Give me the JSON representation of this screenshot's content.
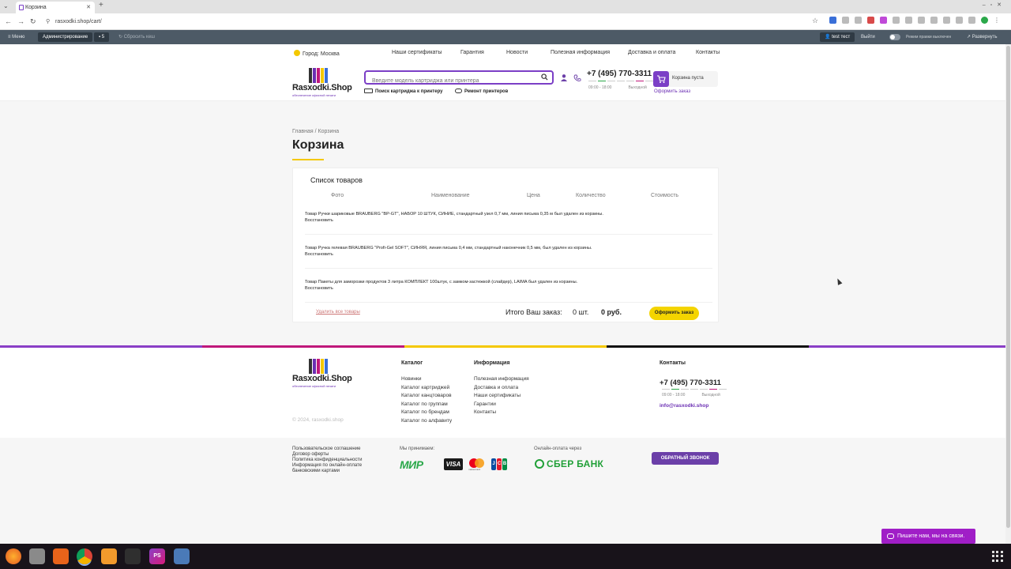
{
  "browser": {
    "tab_title": "Корзина",
    "url": "rasxodki.shop/cart/"
  },
  "adminbar": {
    "menu": "Меню",
    "admin": "Администрирование",
    "comments": "5",
    "reset_cache": "Сбросить кеш",
    "user": "test тест",
    "logout": "Выйти",
    "edit_mode": "Режим правки",
    "edit_state": "выключен",
    "expand": "Развернуть"
  },
  "header": {
    "city": "Город: Москва",
    "nav": [
      "Наши сертификаты",
      "Гарантия",
      "Новости",
      "Полезная информация",
      "Доставка и оплата",
      "Контакты"
    ],
    "logo_text": "Rasxodki.Shop",
    "logo_sub": "обеспечение офисной печати",
    "search_placeholder": "Введите модель картриджа или принтера",
    "link_find_cartridge": "Поиск картриджа к принтеру",
    "link_repair": "Ремонт принтеров",
    "phone": "+7 (495) 770-3311",
    "hours": "09:00 - 18:00",
    "day_off": "Выходной",
    "cart_label": "Корзина пуста",
    "order_link": "Оформить заказ"
  },
  "page": {
    "crumb_home": "Главная",
    "crumb_sep": "/",
    "crumb_current": "Корзина",
    "title": "Корзина"
  },
  "cart": {
    "list_title": "Список товаров",
    "columns": [
      "Фото",
      "Наименование",
      "Цена",
      "Количество",
      "Стоимость"
    ],
    "removed": [
      {
        "text": "Товар Ручки шариковые BRAUBERG \"BP-GT\", НАБОР 10 ШТУК, СИНИЕ, стандартный узел 0,7 мм, линия письма 0,35 м был удален из корзины.",
        "restore": "Восстановить"
      },
      {
        "text": "Товар Ручка гелевая BRAUBERG \"Profi-Gel SOFT\", СИНЯЯ, линия письма 0,4 мм, стандартный наконечник 0,5 мм, был удален из корзины.",
        "restore": "Восстановить"
      },
      {
        "text": "Товар Пакеты для заморозки продуктов 3 литра КОМПЛЕКТ 100штук, с замком-застежкой (слайдер), LAIMA был удален из корзины.",
        "restore": "Восстановить"
      }
    ],
    "delete_all": "Удалить все товары",
    "total_label": "Итого Ваш заказ:",
    "total_qty": "0 шт.",
    "total_sum": "0 руб.",
    "order_button": "Оформить заказ"
  },
  "footer": {
    "catalog_title": "Каталог",
    "catalog_links": [
      "Новинки",
      "Каталог картриджей",
      "Каталог канцтоваров",
      "Каталог по группам",
      "Каталог по брендам",
      "Каталог по алфавиту"
    ],
    "info_title": "Информация",
    "info_links": [
      "Полезная информация",
      "Доставка и оплата",
      "Наши сертификаты",
      "Гарантии",
      "Контакты"
    ],
    "contacts_title": "Контакты",
    "phone": "+7 (495) 770-3311",
    "hours": "09:00 - 18:00",
    "day_off": "Выходной",
    "email": "info@rasxodki.shop",
    "copyright": "© 2024, rasxodki.shop",
    "legal_links": [
      "Пользовательское соглашение",
      "Договор оферты",
      "Политика конфиденциальности",
      "Информация по онлайн-оплате банковскими картами"
    ],
    "accept_label": "Мы принимаем:",
    "pay_mir": "МИР",
    "pay_visa": "VISA",
    "pay_mc": "mastercard",
    "pay_jcb": [
      "J",
      "C",
      "B"
    ],
    "online_label": "Онлайн-оплата через",
    "sber": "СБЕР БАНК",
    "callback": "ОБРАТНЫЙ ЗВОНОК"
  },
  "chat": {
    "label": "Пишите нам, мы на связи."
  },
  "taskbar": {
    "ps_label": "PS"
  },
  "colors": {
    "brand_purple": "#7b3fc6",
    "accent_yellow": "#f4d400",
    "stripe": [
      "#8a3fc6",
      "#c0187a",
      "#f4c800",
      "#111111",
      "#8a3fc6"
    ]
  }
}
